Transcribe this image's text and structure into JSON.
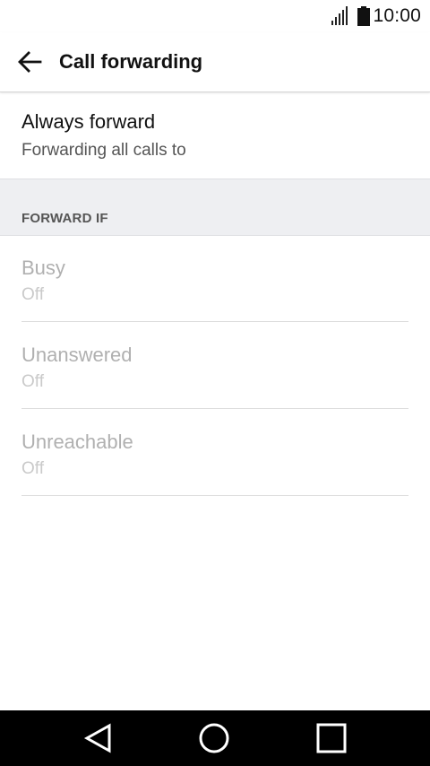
{
  "status_bar": {
    "time": "10:00",
    "signal_icon": "signal-icon",
    "battery_icon": "battery-icon"
  },
  "app_bar": {
    "back_icon": "arrow-left-icon",
    "title": "Call forwarding"
  },
  "always_forward": {
    "title": "Always forward",
    "summary": "Forwarding all calls to"
  },
  "section": {
    "label": "FORWARD IF"
  },
  "forward_options": [
    {
      "title": "Busy",
      "summary": "Off"
    },
    {
      "title": "Unanswered",
      "summary": "Off"
    },
    {
      "title": "Unreachable",
      "summary": "Off"
    }
  ],
  "nav_bar": {
    "back_icon": "triangle-back-icon",
    "home_icon": "circle-home-icon",
    "recents_icon": "square-recents-icon"
  },
  "colors": {
    "title_text": "#111111",
    "summary_text": "#555555",
    "disabled_title": "#b0b0b0",
    "disabled_summary": "#cacaca",
    "section_bg": "#eeeff2",
    "nav_bg": "#000000"
  }
}
